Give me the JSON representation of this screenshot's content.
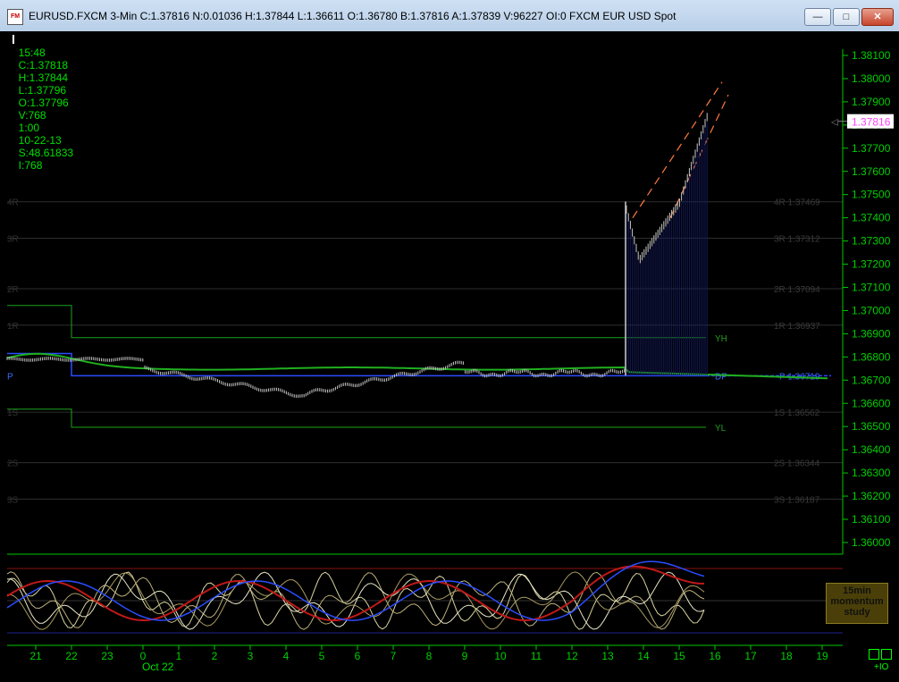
{
  "window": {
    "title": "EURUSD.FXCM 3-Min C:1.37816 N:0.01036 H:1.37844 L:1.36611 O:1.36780 B:1.37816 A:1.37839 V:96227 OI:0 FXCM EUR USD Spot",
    "icon_text": "FM",
    "minimize": "—",
    "maximize": "□",
    "close": "✕"
  },
  "info_bar": {
    "time": "15:48",
    "close": "C:1.37818",
    "high": "H:1.37844",
    "low": "L:1.37796",
    "open": "O:1.37796",
    "volume": "V:768",
    "interval": "1:00",
    "date": "10-22-13",
    "stat": "S:48.61833",
    "i": "I:768"
  },
  "price_axis": {
    "ticks": [
      "1.38100",
      "1.38000",
      "1.37900",
      "1.37800",
      "1.37700",
      "1.37600",
      "1.37500",
      "1.37400",
      "1.37300",
      "1.37200",
      "1.37100",
      "1.37000",
      "1.36900",
      "1.36800",
      "1.36700",
      "1.36600",
      "1.36500",
      "1.36400",
      "1.36300",
      "1.36200",
      "1.36100",
      "1.36000"
    ],
    "current_price": "1.37816",
    "current_marker": "◁"
  },
  "pivot_levels": [
    {
      "left": "4R",
      "right": "4R  1.37469"
    },
    {
      "left": "3R",
      "right": "3R  1.37312"
    },
    {
      "left": "2R",
      "right": "2R  1.37094"
    },
    {
      "left": "1R",
      "right": "1R  1.36937"
    },
    {
      "left": "P",
      "right": "P  1.36719"
    },
    {
      "left": "1S",
      "right": "1S  1.36562"
    },
    {
      "left": "2S",
      "right": "2S  1.36344"
    },
    {
      "left": "3S",
      "right": "3S  1.36187"
    }
  ],
  "line_labels": {
    "yh": "YH",
    "dp": "DP",
    "yl": "YL"
  },
  "time_axis": {
    "ticks": [
      "21",
      "22",
      "23",
      "0",
      "1",
      "2",
      "3",
      "4",
      "5",
      "6",
      "7",
      "8",
      "9",
      "10",
      "11",
      "12",
      "13",
      "14",
      "15",
      "16",
      "17",
      "18",
      "19"
    ],
    "date_label": "Oct 22"
  },
  "momentum": {
    "line1": "15min",
    "line2": "momentum",
    "line3": "study"
  },
  "corner": {
    "plus_io": "+IO"
  },
  "colors": {
    "background": "#000000",
    "axis": "#00c800",
    "pivot": "#2e2e2e",
    "green_line": "#1aa31a",
    "blue_line": "#2a4cff",
    "bars": "#c8c8c8",
    "channel": "#ff7a3c",
    "current": "#ff40ff"
  }
}
